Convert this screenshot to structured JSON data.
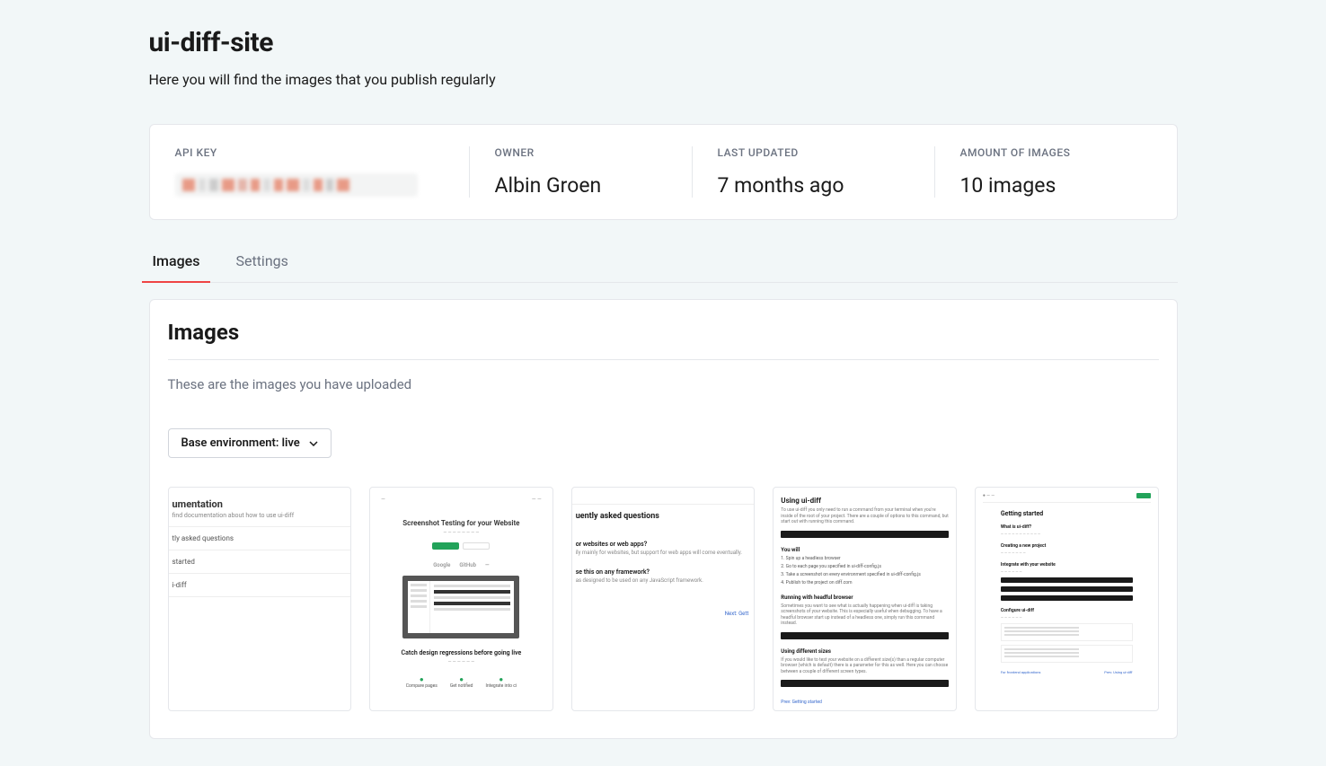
{
  "header": {
    "title": "ui-diff-site",
    "subtitle": "Here you will find the images that you publish regularly"
  },
  "info": {
    "api_key_label": "API KEY",
    "owner_label": "OWNER",
    "owner_value": "Albin Groen",
    "last_updated_label": "LAST UPDATED",
    "last_updated_value": "7 months ago",
    "count_label": "AMOUNT OF IMAGES",
    "count_value": "10 images"
  },
  "tabs": {
    "images": "Images",
    "settings": "Settings"
  },
  "section": {
    "title": "Images",
    "description": "These are the images you have uploaded",
    "env_dropdown": "Base environment: live"
  },
  "thumbnails": {
    "t1": {
      "h": "umentation",
      "sub": "find documentation about how to use ui-diff",
      "r1": "tly asked questions",
      "r2": "started",
      "r3": "i-diff"
    },
    "t2": {
      "title": "Screenshot Testing for your Website",
      "logo1": "Google",
      "logo2": "GitHub",
      "catch": "Catch design regressions before going live",
      "f1": "Compare pages",
      "f2": "Get notified",
      "f3": "Integrate into ci"
    },
    "t3": {
      "h": "uently asked questions",
      "q1": "or websites or web apps?",
      "a1": "ily mainly for websites, but support for web apps will come eventually.",
      "q2": "se this on any framework?",
      "a2": "as designed to be used on any JavaScript framework.",
      "next": "Next: Gett"
    },
    "t4": {
      "h": "Using ui-diff",
      "p1": "To use ui-diff you only need to run a command from your terminal when you're inside of the root of your project. There are a couple of options to this command, but start out with running this command.",
      "sub1": "You will",
      "li1": "1. Spin up a headless browser",
      "li2": "2. Go to each page you specified in ui-diff-config.js",
      "li3": "3. Take a screenshot on every environment specified in ui-diff-config.js",
      "li4": "4. Publish to the project on diff.com",
      "sub2": "Running with headful browser",
      "p2": "Sometimes you want to see what is actually happening when ui-diff is taking screenshots of your website. This is especially useful when debugging. To have a headful browser start up instead of a headless one, simply run this command instead.",
      "sub3": "Using different sizes",
      "p3": "If you would like to test your website on a different size(s) than a regular computer browser (which is default) there is a parameter for this as well. Here you can choose between a couple of different screen types.",
      "link": "Prev: Getting started"
    },
    "t5": {
      "h": "Getting started",
      "sh1": "What is ui-diff?",
      "sh2": "Creating a new project",
      "sh3": "Integrate with your website",
      "sh4": "Configure ui-diff",
      "l1": "For frontend applications",
      "l2": "Prev: Using ui-diff"
    }
  }
}
